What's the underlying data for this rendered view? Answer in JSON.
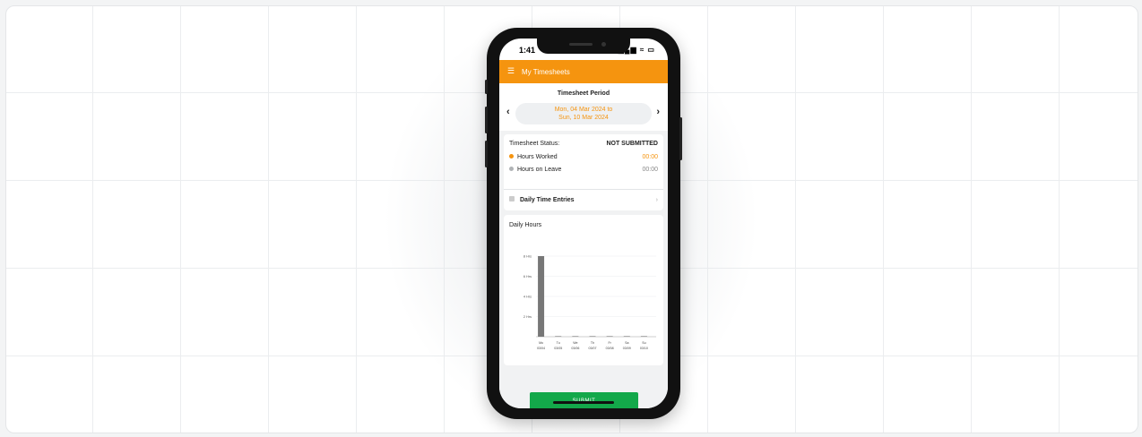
{
  "status_bar": {
    "time": "1:41",
    "icons": "▂▄▆ ≈ ▭"
  },
  "app_bar": {
    "menu_icon": "hamburger-icon",
    "title": "My Timesheets"
  },
  "period": {
    "label": "Timesheet Period",
    "line1": "Mon, 04 Mar 2024 to",
    "line2": "Sun, 10 Mar 2024",
    "prev_glyph": "‹",
    "next_glyph": "›"
  },
  "status": {
    "label": "Timesheet Status:",
    "value": "NOT SUBMITTED",
    "hours_worked_label": "Hours Worked",
    "hours_worked_value": "00:00",
    "hours_leave_label": "Hours on Leave",
    "hours_leave_value": "00:00",
    "daily_entries_label": "Daily Time Entries",
    "chevron": "›"
  },
  "colors": {
    "accent": "#f5940f",
    "submit": "#13a84a",
    "leave_dot": "#b0b3b6",
    "bar": "#777777"
  },
  "chart_data": {
    "type": "bar",
    "title": "Daily Hours",
    "categories": [
      [
        "Mo",
        "03/04"
      ],
      [
        "Tu",
        "03/05"
      ],
      [
        "We",
        "03/06"
      ],
      [
        "Th",
        "03/07"
      ],
      [
        "Fr",
        "03/08"
      ],
      [
        "Sa",
        "03/09"
      ],
      [
        "Su",
        "03/10"
      ]
    ],
    "values": [
      8,
      0,
      0,
      0,
      0,
      0,
      0
    ],
    "yticks": [
      {
        "value": 2,
        "label": "2 Hrs"
      },
      {
        "value": 4,
        "label": "4 Hrs"
      },
      {
        "value": 6,
        "label": "6 Hrs"
      },
      {
        "value": 8,
        "label": "8 Hrs"
      }
    ],
    "ylim": [
      0,
      8
    ],
    "grid": true
  },
  "submit_label": "SUBMIT"
}
